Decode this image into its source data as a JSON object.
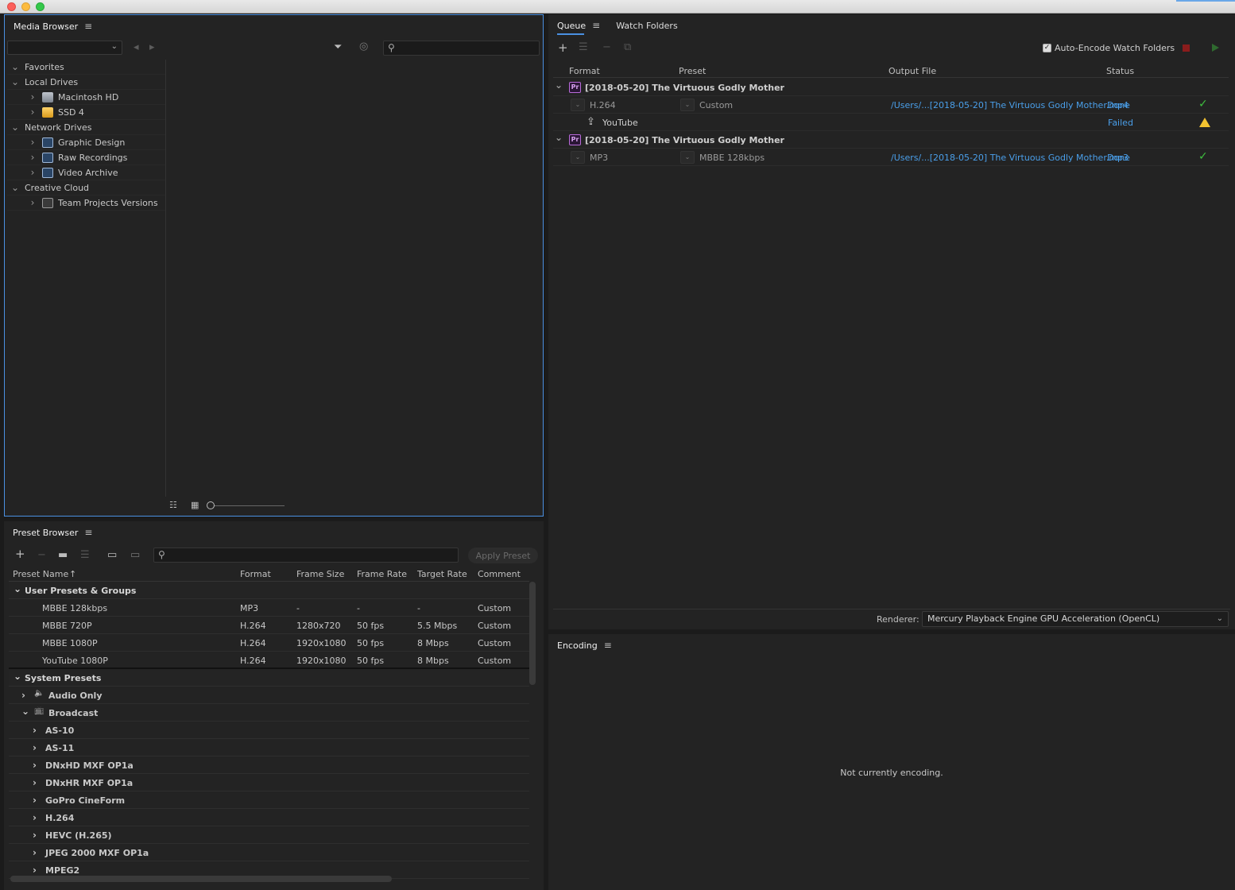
{
  "media_browser": {
    "title": "Media Browser",
    "menu_icon": "hamburger-menu-icon",
    "tree": [
      {
        "label": "Favorites",
        "level": 0,
        "expanded": true,
        "icon": ""
      },
      {
        "label": "Local Drives",
        "level": 0,
        "expanded": true,
        "icon": ""
      },
      {
        "label": "Macintosh HD",
        "level": 1,
        "expanded": false,
        "icon": "hard-drive-icon"
      },
      {
        "label": "SSD 4",
        "level": 1,
        "expanded": false,
        "icon": "ssd-drive-icon"
      },
      {
        "label": "Network Drives",
        "level": 0,
        "expanded": true,
        "icon": ""
      },
      {
        "label": "Graphic Design",
        "level": 1,
        "expanded": false,
        "icon": "network-drive-icon"
      },
      {
        "label": "Raw Recordings",
        "level": 1,
        "expanded": false,
        "icon": "network-drive-icon"
      },
      {
        "label": "Video Archive",
        "level": 1,
        "expanded": false,
        "icon": "network-drive-icon"
      },
      {
        "label": "Creative Cloud",
        "level": 0,
        "expanded": true,
        "icon": ""
      },
      {
        "label": "Team Projects Versions",
        "level": 1,
        "expanded": false,
        "icon": "team-projects-icon"
      }
    ]
  },
  "preset_browser": {
    "title": "Preset Browser",
    "apply_button": "Apply Preset",
    "columns": [
      "Preset Name",
      "Format",
      "Frame Size",
      "Frame Rate",
      "Target Rate",
      "Comment"
    ],
    "user_group": "User Presets & Groups",
    "user_presets": [
      {
        "name": "MBBE 128kbps",
        "format": "MP3",
        "frame_size": "-",
        "frame_rate": "-",
        "target_rate": "-",
        "comment": "Custom"
      },
      {
        "name": "MBBE 720P",
        "format": "H.264",
        "frame_size": "1280x720",
        "frame_rate": "50 fps",
        "target_rate": "5.5 Mbps",
        "comment": "Custom"
      },
      {
        "name": "MBBE 1080P",
        "format": "H.264",
        "frame_size": "1920x1080",
        "frame_rate": "50 fps",
        "target_rate": "8 Mbps",
        "comment": "Custom"
      },
      {
        "name": "YouTube 1080P",
        "format": "H.264",
        "frame_size": "1920x1080",
        "frame_rate": "50 fps",
        "target_rate": "8 Mbps",
        "comment": "Custom"
      }
    ],
    "system_group": "System Presets",
    "system_items": [
      {
        "label": "Audio Only",
        "level": 1,
        "expanded": false,
        "icon": "speaker-icon"
      },
      {
        "label": "Broadcast",
        "level": 1,
        "expanded": true,
        "icon": "tv-icon"
      },
      {
        "label": "AS-10",
        "level": 2,
        "expanded": false,
        "icon": ""
      },
      {
        "label": "AS-11",
        "level": 2,
        "expanded": false,
        "icon": ""
      },
      {
        "label": "DNxHD MXF OP1a",
        "level": 2,
        "expanded": false,
        "icon": ""
      },
      {
        "label": "DNxHR MXF OP1a",
        "level": 2,
        "expanded": false,
        "icon": ""
      },
      {
        "label": "GoPro CineForm",
        "level": 2,
        "expanded": false,
        "icon": ""
      },
      {
        "label": "H.264",
        "level": 2,
        "expanded": false,
        "icon": ""
      },
      {
        "label": "HEVC (H.265)",
        "level": 2,
        "expanded": false,
        "icon": ""
      },
      {
        "label": "JPEG 2000 MXF OP1a",
        "level": 2,
        "expanded": false,
        "icon": ""
      },
      {
        "label": "MPEG2",
        "level": 2,
        "expanded": false,
        "icon": ""
      }
    ]
  },
  "queue": {
    "tabs": [
      "Queue",
      "Watch Folders"
    ],
    "auto_encode_label": "Auto-Encode Watch Folders",
    "auto_encode_checked": true,
    "columns": [
      "Format",
      "Preset",
      "Output File",
      "Status"
    ],
    "items": [
      {
        "source": "[2018-05-20] The Virtuous Godly Mother",
        "outputs": [
          {
            "format": "H.264",
            "preset": "Custom",
            "output_file": "/Users/...[2018-05-20] The Virtuous Godly Mother.mp4",
            "status": "Done",
            "status_icon": "checkmark-icon"
          },
          {
            "format": "YouTube",
            "preset": "",
            "output_file": "",
            "status": "Failed",
            "status_icon": "warning-icon",
            "publish": true
          }
        ]
      },
      {
        "source": "[2018-05-20] The Virtuous Godly Mother",
        "outputs": [
          {
            "format": "MP3",
            "preset": "MBBE 128kbps",
            "output_file": "/Users/...[2018-05-20] The Virtuous Godly Mother.mp3",
            "status": "Done",
            "status_icon": "checkmark-icon"
          }
        ]
      }
    ],
    "renderer_label": "Renderer:",
    "renderer_value": "Mercury Playback Engine GPU Acceleration (OpenCL)"
  },
  "encoding": {
    "title": "Encoding",
    "message": "Not currently encoding."
  },
  "colors": {
    "accent": "#4a90e2",
    "link": "#4a9fea",
    "ok": "#3fbf3f",
    "warning": "#f2c230",
    "panel_bg": "#232323"
  }
}
